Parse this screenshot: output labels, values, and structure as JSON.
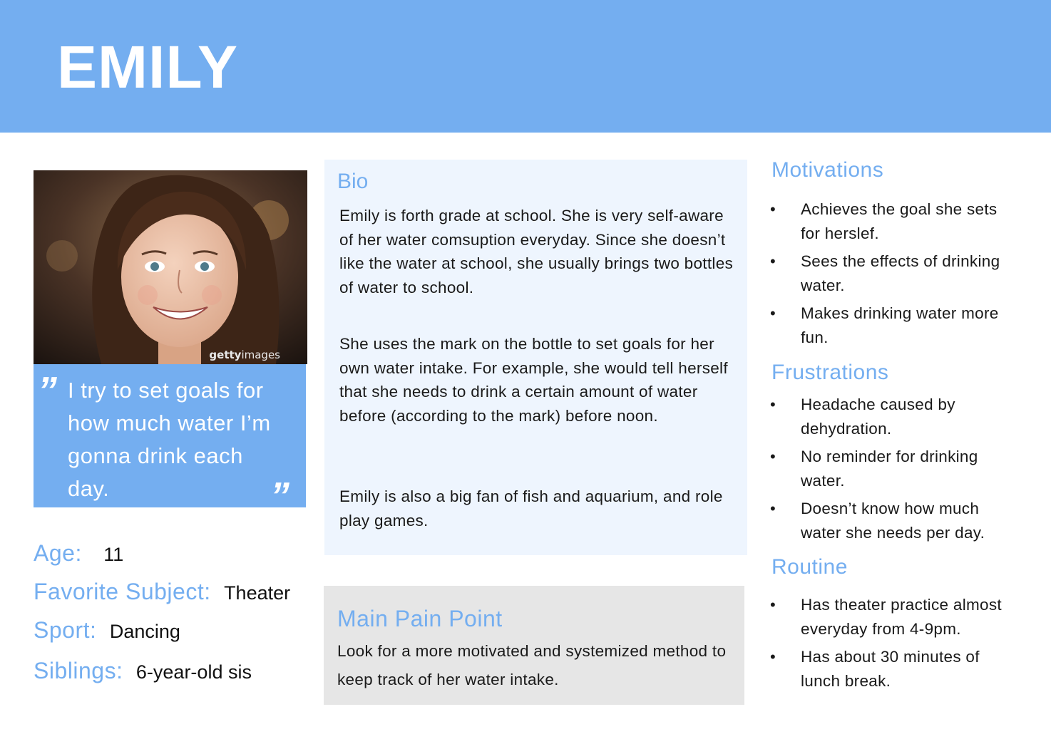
{
  "persona": {
    "name": "EMILY"
  },
  "photo": {
    "watermark_bold": "getty",
    "watermark_rest": "images"
  },
  "quote": {
    "open_mark": "”",
    "close_mark": "”",
    "text": "I try to set goals for how much water I’m gonna drink each day."
  },
  "details": {
    "age_label": "Age:",
    "age_value": "11",
    "subject_label": "Favorite Subject:",
    "subject_value": "Theater",
    "sport_label": "Sport:",
    "sport_value": "Dancing",
    "siblings_label": "Siblings:",
    "siblings_value": "6-year-old sis"
  },
  "bio": {
    "title": "Bio",
    "paragraphs": [
      "Emily is forth grade at school. She is very self-aware of her water comsuption everyday. Since she doesn’t like the water at school, she usually brings two bottles of water to school.",
      "She uses the mark on the bottle to set goals for her own water intake. For example, she would tell herself that she needs to drink a certain amount of water before (according to the mark) before noon.",
      "Emily is also a big fan of fish and aquarium, and role play games."
    ]
  },
  "pain_point": {
    "title": "Main Pain Point",
    "text": "Look for a more motivated and systemized method to keep track of her water intake."
  },
  "motivations": {
    "title": "Motivations",
    "items": [
      "Achieves the goal she sets for herslef.",
      "Sees the effects of drinking water.",
      "Makes drinking water more fun."
    ]
  },
  "frustrations": {
    "title": "Frustrations",
    "items": [
      "Headache caused by dehydration.",
      "No reminder for drinking water.",
      "Doesn’t know how much water she needs per day."
    ]
  },
  "routine": {
    "title": "Routine",
    "items": [
      "Has theater practice almost everyday from 4-9pm.",
      "Has about 30 minutes of lunch break."
    ]
  },
  "bullet_glyph": "•",
  "colors": {
    "accent": "#74aef0",
    "bio_bg": "#eef5fe",
    "pain_bg": "#e6e6e6"
  }
}
